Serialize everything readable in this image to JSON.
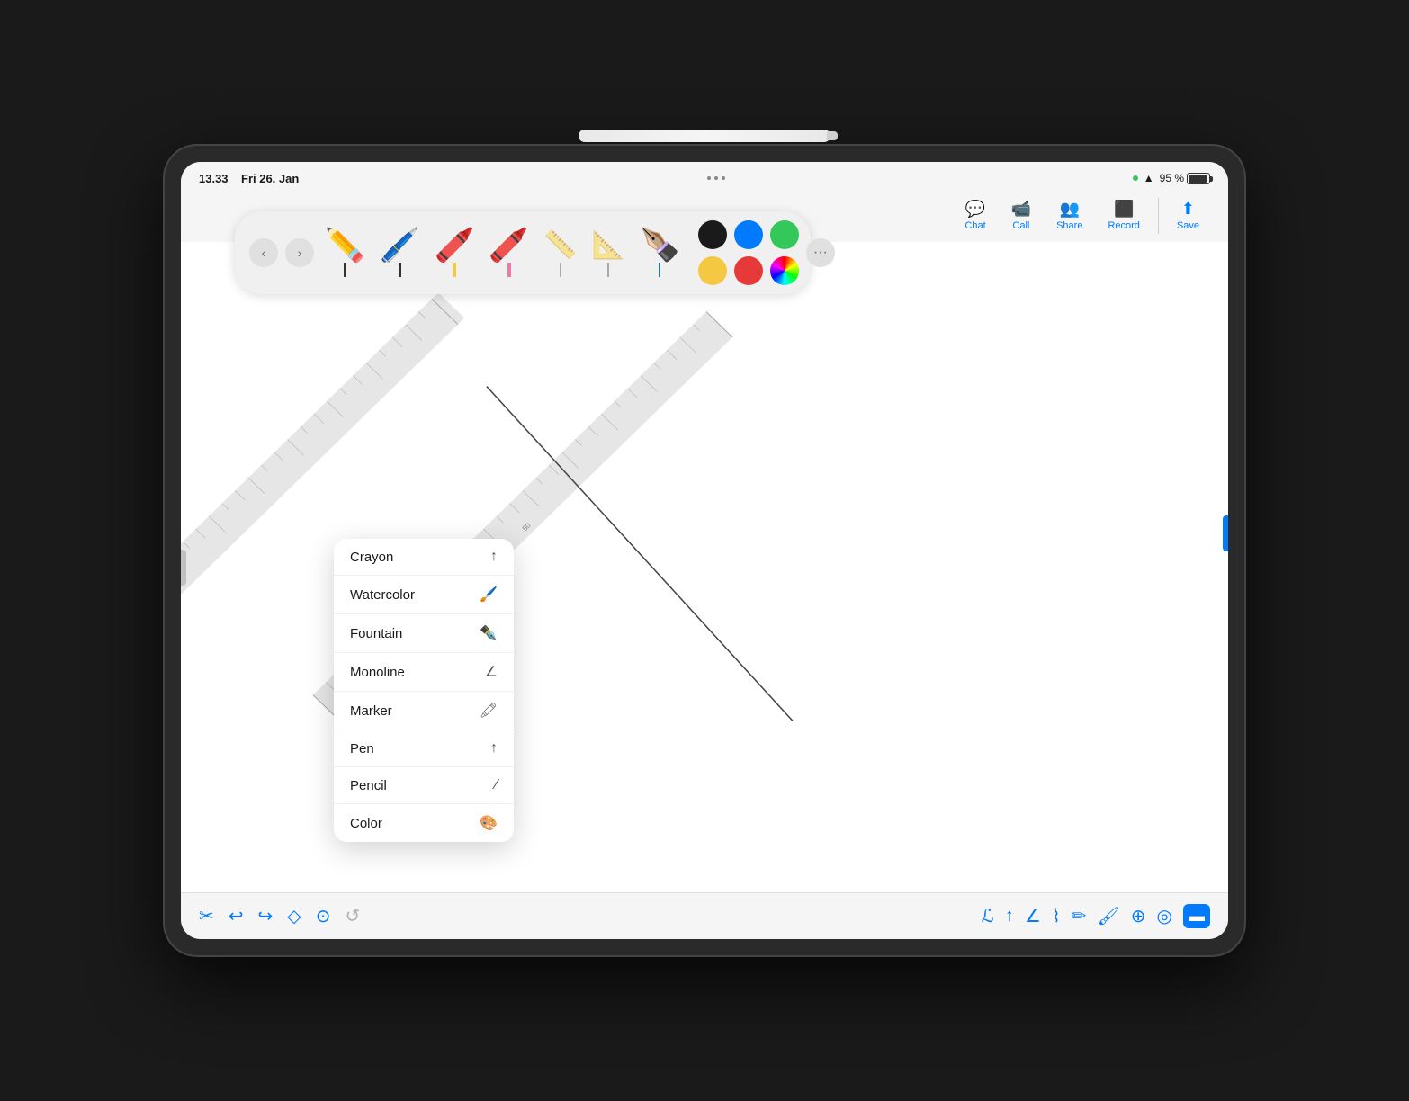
{
  "device": {
    "pencil_alt": "Apple Pencil"
  },
  "status_bar": {
    "time": "13.33",
    "date": "Fri 26. Jan",
    "battery_percent": "95 %"
  },
  "toolbar": {
    "chat_label": "Chat",
    "call_label": "Call",
    "share_label": "Share",
    "record_label": "Record",
    "save_label": "Save"
  },
  "pen_toolbar": {
    "back_label": "←",
    "forward_label": "→",
    "more_label": "···",
    "tools": [
      {
        "name": "pencil-tool",
        "icon": "✏️",
        "line_color": "#333"
      },
      {
        "name": "pen-tool",
        "icon": "🖊️",
        "line_color": "#333"
      },
      {
        "name": "marker-tool-yellow",
        "icon": "🖍️",
        "line_color": "#f5c842"
      },
      {
        "name": "marker-tool-pink",
        "icon": "🖍️",
        "line_color": "#e87ba8"
      },
      {
        "name": "ruler-tool-1",
        "icon": "📏"
      },
      {
        "name": "ruler-tool-2",
        "icon": "📐"
      },
      {
        "name": "pen-blue-tool",
        "icon": "🖊️",
        "line_color": "#007aff"
      }
    ],
    "colors": {
      "row1": [
        "#1a1a1a",
        "#007aff",
        "#34c759"
      ],
      "row2": [
        "#f5c842",
        "#e8393a",
        "#bf6af2"
      ]
    }
  },
  "context_menu": {
    "items": [
      {
        "label": "Crayon",
        "icon": "✏️"
      },
      {
        "label": "Watercolor",
        "icon": "🖌️"
      },
      {
        "label": "Fountain",
        "icon": "✒️"
      },
      {
        "label": "Monoline",
        "icon": "∕"
      },
      {
        "label": "Marker",
        "icon": "🖍"
      },
      {
        "label": "Pen",
        "icon": "✒"
      },
      {
        "label": "Pencil",
        "icon": "/"
      },
      {
        "label": "Color",
        "icon": "🎨"
      }
    ]
  },
  "bottom_toolbar": {
    "left_icons": [
      {
        "name": "scissors-icon",
        "symbol": "✂️"
      },
      {
        "name": "undo-icon",
        "symbol": "↩"
      },
      {
        "name": "redo-icon",
        "symbol": "↪"
      },
      {
        "name": "eraser-icon",
        "symbol": "⌫"
      },
      {
        "name": "lasso-icon",
        "symbol": "⭕"
      },
      {
        "name": "action-icon",
        "symbol": "↩️"
      }
    ],
    "right_icons": [
      {
        "name": "calligraphy-icon",
        "symbol": "𝓐"
      },
      {
        "name": "pen2-icon",
        "symbol": "✒"
      },
      {
        "name": "angle-icon",
        "symbol": "∠"
      },
      {
        "name": "marker2-icon",
        "symbol": "🖍"
      },
      {
        "name": "fountain-icon",
        "symbol": "✏"
      },
      {
        "name": "brush-icon",
        "symbol": "🖌"
      },
      {
        "name": "eyedropper-icon",
        "symbol": "💉"
      },
      {
        "name": "palette-icon",
        "symbol": "🎨"
      },
      {
        "name": "layers-icon",
        "symbol": "▬",
        "active": true
      }
    ]
  }
}
